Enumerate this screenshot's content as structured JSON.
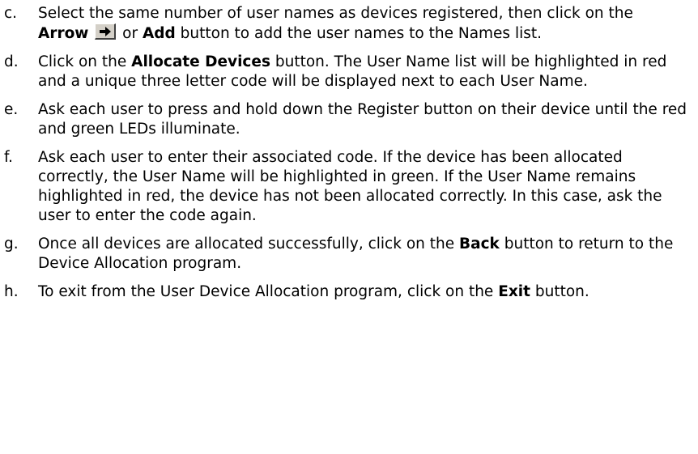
{
  "steps": [
    {
      "marker": "c.",
      "parts": [
        {
          "t": "Select the same number of user names as devices registered, then click on the "
        },
        {
          "b": "Arrow"
        },
        {
          "t": " "
        },
        {
          "icon": "arrow-right-icon"
        },
        {
          "t": " or "
        },
        {
          "b": "Add"
        },
        {
          "t": " button to add the user names to the Names list."
        }
      ]
    },
    {
      "marker": "d.",
      "parts": [
        {
          "t": "Click on the "
        },
        {
          "b": "Allocate Devices"
        },
        {
          "t": " button. The User Name list will be highlighted in red and a unique three letter code will be displayed next to each User Name."
        }
      ]
    },
    {
      "marker": "e.",
      "parts": [
        {
          "t": "Ask each user to press and hold down the Register button on their device until the red and green LEDs illuminate."
        }
      ]
    },
    {
      "marker": "f.",
      "parts": [
        {
          "t": "Ask each user to enter their associated code. If the device has been allocated correctly, the User Name will be highlighted in green. If the User Name remains highlighted in red, the device has not been allocated correctly. In this case, ask the user to enter the code again."
        }
      ]
    },
    {
      "marker": "g.",
      "parts": [
        {
          "t": "Once all devices are allocated successfully, click on the "
        },
        {
          "b": "Back"
        },
        {
          "t": " button to return to the Device Allocation program."
        }
      ]
    },
    {
      "marker": "h.",
      "parts": [
        {
          "t": "To exit from the User Device Allocation program, click on the "
        },
        {
          "b": "Exit"
        },
        {
          "t": " button."
        }
      ]
    }
  ]
}
